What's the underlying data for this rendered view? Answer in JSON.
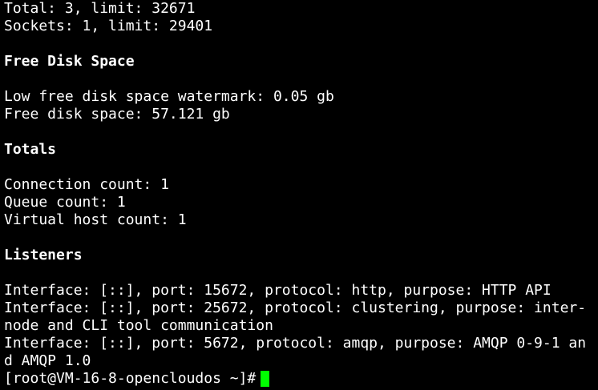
{
  "terminal": {
    "cursor_color": "#00ff00",
    "background_color": "#000000",
    "text_color": "#ffffff",
    "lines": {
      "total_fds": "Total: 3, limit: 32671",
      "sockets": "Sockets: 1, limit: 29401",
      "free_disk_heading": "Free Disk Space",
      "low_watermark": "Low free disk space watermark: 0.05 gb",
      "free_disk": "Free disk space: 57.121 gb",
      "totals_heading": "Totals",
      "connection_count": "Connection count: 1",
      "queue_count": "Queue count: 1",
      "vhost_count": "Virtual host count: 1",
      "listeners_heading": "Listeners",
      "listener_1": "Interface: [::], port: 15672, protocol: http, purpose: HTTP API",
      "listener_2a": "Interface: [::], port: 25672, protocol: clustering, purpose: inter-",
      "listener_2b": "node and CLI tool communication",
      "listener_3a": "Interface: [::], port: 5672, protocol: amqp, purpose: AMQP 0-9-1 an",
      "listener_3b": "d AMQP 1.0"
    },
    "prompt": "[root@VM-16-8-opencloudos ~]#"
  }
}
